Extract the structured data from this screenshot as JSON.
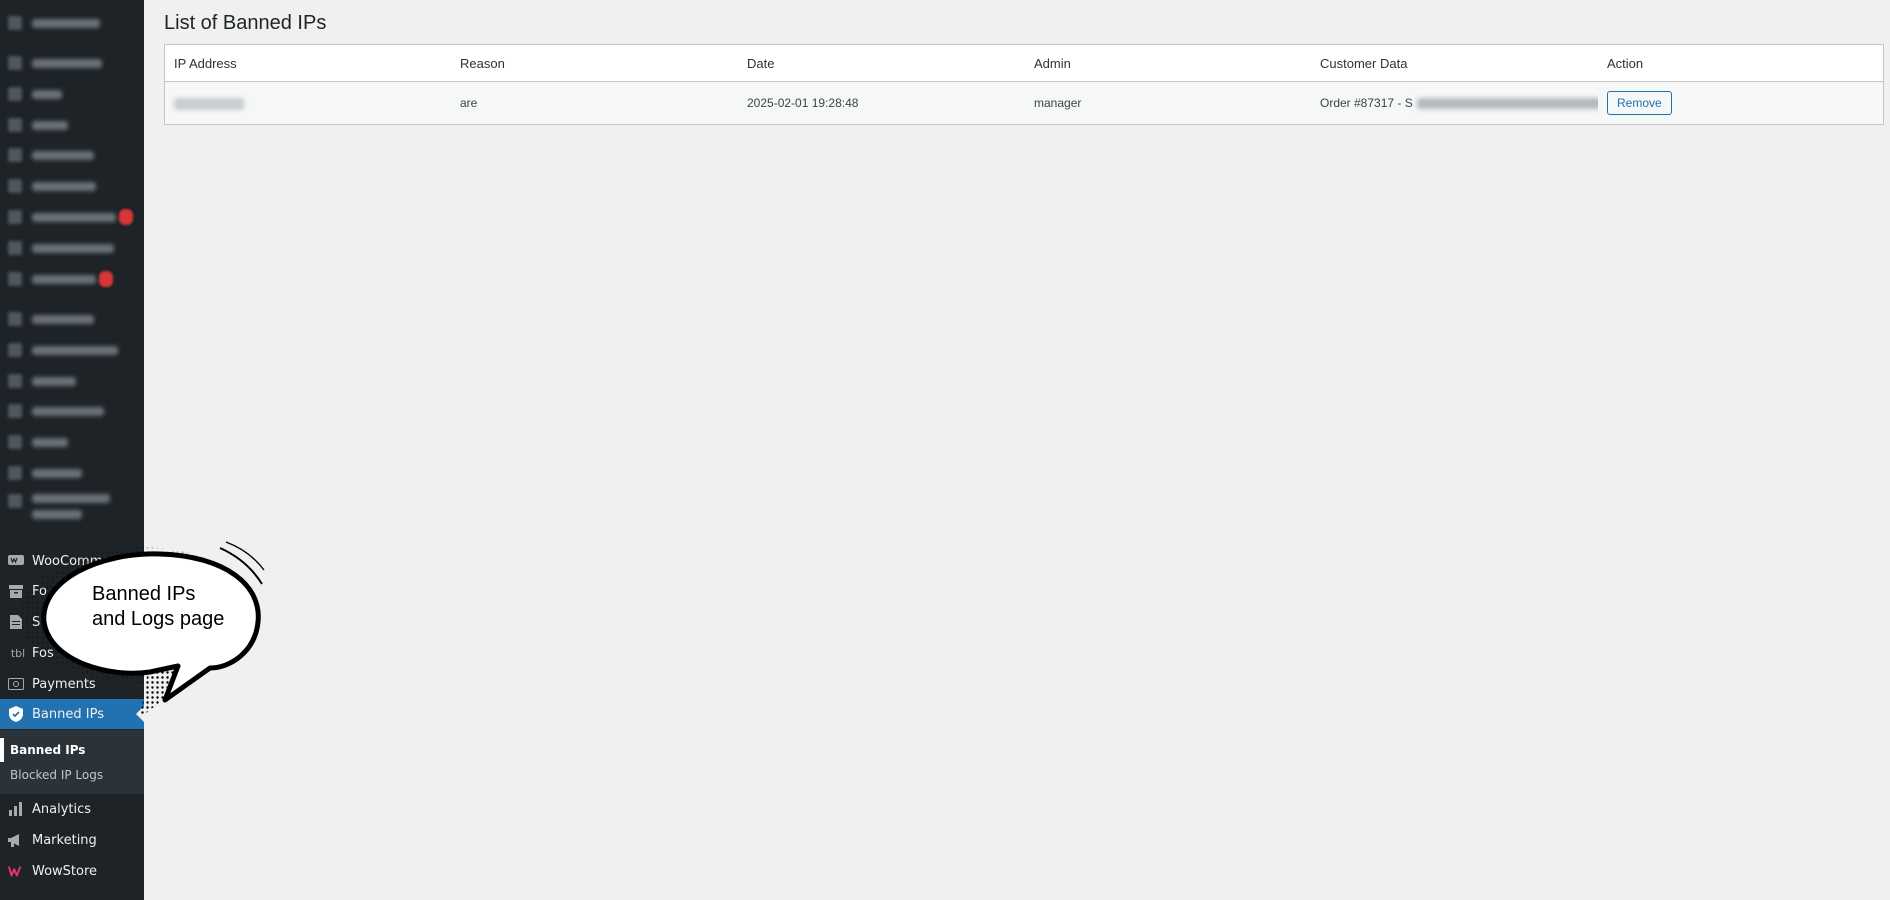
{
  "sidebar": {
    "items": [
      {
        "label": "WooCommerce",
        "icon": "woocommerce-icon"
      },
      {
        "label": "Fo",
        "icon": "archive-icon"
      },
      {
        "label": "S",
        "icon": "page-icon"
      },
      {
        "label": "Fos",
        "icon": "tbl-icon"
      },
      {
        "label": "Payments",
        "icon": "payments-icon"
      },
      {
        "label": "Banned IPs",
        "icon": "shield-icon"
      },
      {
        "label": "Analytics",
        "icon": "bar-chart-icon"
      },
      {
        "label": "Marketing",
        "icon": "megaphone-icon"
      },
      {
        "label": "WowStore",
        "icon": "wowstore-icon"
      }
    ],
    "submenu": [
      {
        "label": "Banned IPs"
      },
      {
        "label": "Blocked IP Logs"
      }
    ],
    "tbl_glyph": "tbl"
  },
  "main": {
    "title": "List of Banned IPs",
    "table": {
      "headers": [
        "IP Address",
        "Reason",
        "Date",
        "Admin",
        "Customer Data",
        "Action"
      ],
      "rows": [
        {
          "reason": "are",
          "date": "2025-02-01 19:28:48",
          "admin": "manager",
          "customer_data": "Order #87317 - S",
          "action_label": "Remove"
        }
      ]
    }
  },
  "callout": {
    "line1": "Banned IPs",
    "line2": "and Logs page"
  },
  "colors": {
    "sidebar_bg": "#1d2327",
    "active_bg": "#2271b1",
    "page_bg": "#f0f0f1"
  }
}
